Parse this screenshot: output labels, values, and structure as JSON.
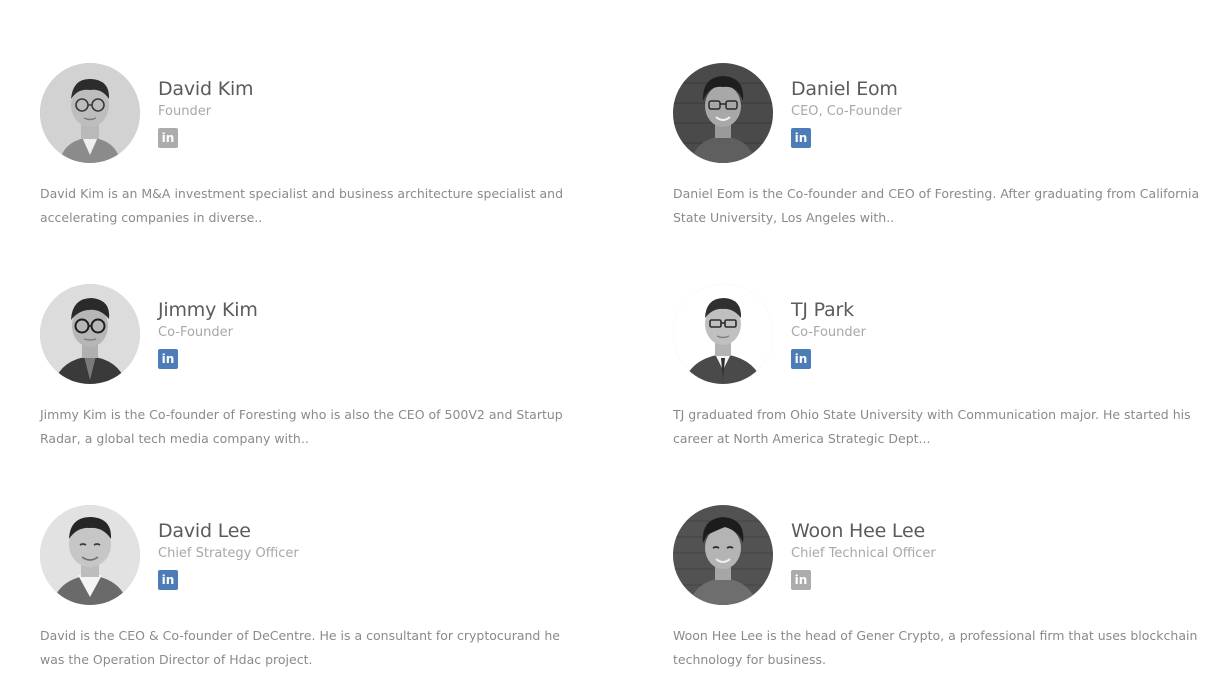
{
  "team": {
    "members": [
      {
        "name": "David Kim",
        "role": "Founder",
        "bio": "David Kim is an M&A investment specialist and business architecture specialist and accelerating companies in diverse..",
        "linkedin_icon": "linkedin-icon"
      },
      {
        "name": "Daniel Eom",
        "role": "CEO, Co-Founder",
        "bio": "Daniel Eom is the Co-founder and CEO of Foresting. After graduating from California State University, Los Angeles with..",
        "linkedin_icon": "linkedin-icon"
      },
      {
        "name": "Jimmy Kim",
        "role": "Co-Founder",
        "bio": "Jimmy Kim is the Co-founder of Foresting who is also the CEO of 500V2 and Startup Radar, a global tech media company with..",
        "linkedin_icon": "linkedin-icon"
      },
      {
        "name": "TJ Park",
        "role": "Co-Founder",
        "bio": "TJ graduated from Ohio State University with Communication major. He started his career at North America Strategic Dept...",
        "linkedin_icon": "linkedin-icon"
      },
      {
        "name": "David Lee",
        "role": "Chief Strategy Officer",
        "bio": "David is the CEO & Co-founder of DeCentre. He is a consultant for cryptocurand he was the Operation Director of Hdac project.",
        "linkedin_icon": "linkedin-icon"
      },
      {
        "name": "Woon Hee Lee",
        "role": "Chief Technical Officer",
        "bio": "Woon Hee Lee is the head of Gener Crypto, a professional firm that uses blockchain technology for business.",
        "linkedin_icon": "linkedin-icon"
      }
    ]
  },
  "colors": {
    "name_text": "#5b5b5b",
    "role_text": "#a8a8a8",
    "bio_text": "#8a8a8a",
    "linkedin_active": "#4d7db6",
    "linkedin_inactive": "#acacac"
  }
}
